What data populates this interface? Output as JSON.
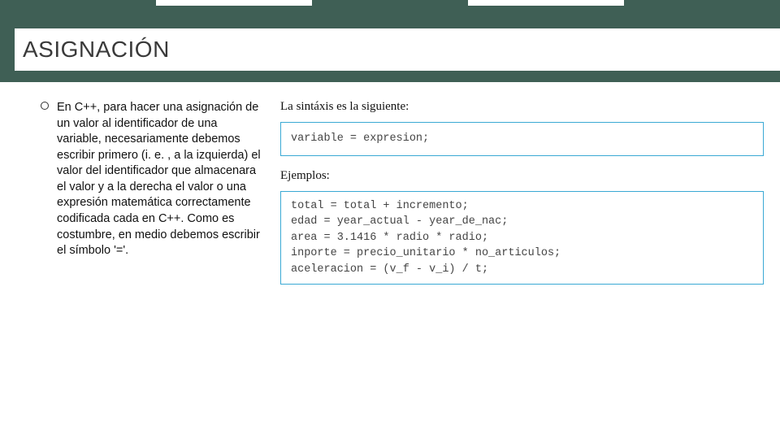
{
  "slide": {
    "title": "ASIGNACIÓN"
  },
  "bullet": {
    "text": "En C++, para hacer una asignación de un valor al identificador de una variable, necesariamente debemos escribir primero (i. e. , a la izquierda) el valor del identificador que almacenara el valor y a la derecha el valor o una expresión matemática correctamente codificada cada en C++. Como es costumbre, en medio debemos escribir el símbolo '='."
  },
  "right": {
    "syntax_label": "La sintáxis es la siguiente:",
    "syntax_code": "variable = expresion;",
    "examples_label": "Ejemplos:",
    "examples_code": "total = total + incremento;\nedad = year_actual - year_de_nac;\narea = 3.1416 * radio * radio;\ninporte = precio_unitario * no_articulos;\naceleracion = (v_f - v_i) / t;"
  }
}
